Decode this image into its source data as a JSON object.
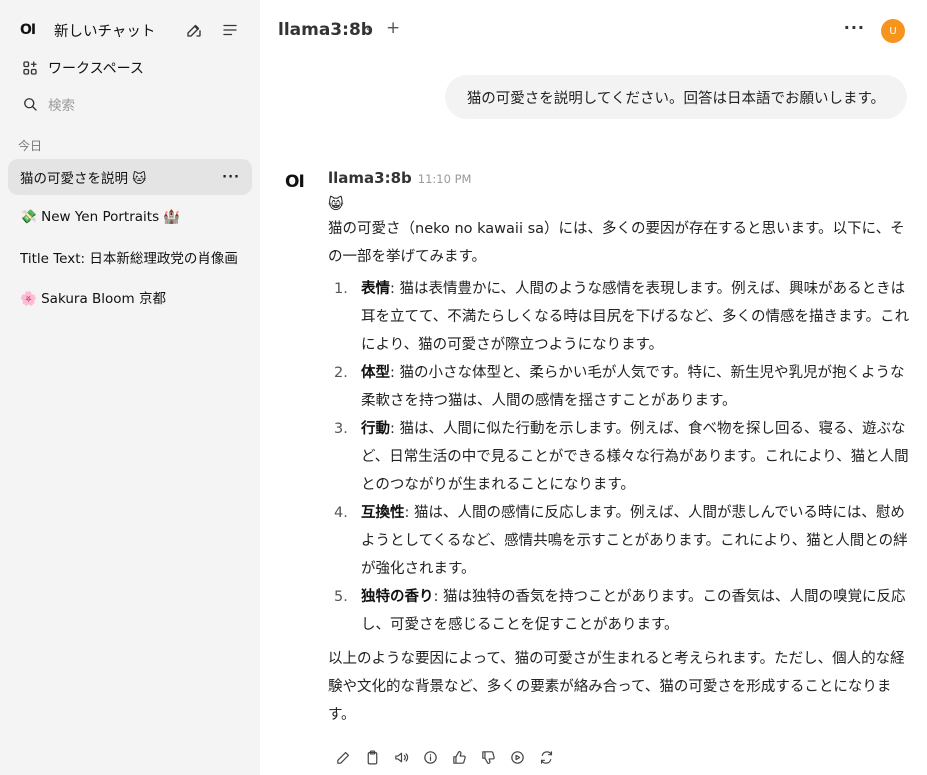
{
  "sidebar": {
    "logo": "OI",
    "new_chat": "新しいチャット",
    "workspace": "ワークスペース",
    "search_placeholder": "検索",
    "section_today": "今日",
    "chats": [
      {
        "label": "猫の可愛さを説明 🐱"
      },
      {
        "label": "💸 New Yen Portraits 🏰"
      },
      {
        "label": "Title Text: 日本新総理政党の肖像画"
      },
      {
        "label": "🌸 Sakura Bloom 京都"
      }
    ]
  },
  "header": {
    "model": "llama3:8b",
    "chevron": "⌄",
    "plus": "+",
    "more": "···",
    "avatar_initial": "U",
    "avatar_color": "#f7941d"
  },
  "user_message": "猫の可愛さを説明してください。回答は日本語でお願いします。",
  "assistant": {
    "logo": "OI",
    "name": "llama3:8b",
    "time": "11:10 PM",
    "emoji": "😸",
    "intro": "猫の可愛さ（neko no kawaii sa）には、多くの要因が存在すると思います。以下に、その一部を挙げてみます。",
    "points": [
      {
        "num": "1.",
        "title": "表情",
        "text": ": 猫は表情豊かに、人間のような感情を表現します。例えば、興味があるときは耳を立てて、不満たらしくなる時は目尻を下げるなど、多くの情感を描きます。これにより、猫の可愛さが際立つようになります。"
      },
      {
        "num": "2.",
        "title": "体型",
        "text": ": 猫の小さな体型と、柔らかい毛が人気です。特に、新生児や乳児が抱くような柔軟さを持つ猫は、人間の感情を揺さすことがあります。"
      },
      {
        "num": "3.",
        "title": "行動",
        "text": ": 猫は、人間に似た行動を示します。例えば、食べ物を探し回る、寝る、遊ぶなど、日常生活の中で見ることができる様々な行為があります。これにより、猫と人間とのつながりが生まれることになります。"
      },
      {
        "num": "4.",
        "title": "互換性",
        "text": ": 猫は、人間の感情に反応します。例えば、人間が悲しんでいる時には、慰めようとしてくるなど、感情共鳴を示すことがあります。これにより、猫と人間との絆が強化されます。"
      },
      {
        "num": "5.",
        "title": "独特の香り",
        "text": ": 猫は独特の香気を持つことがあります。この香気は、人間の嗅覚に反応し、可愛さを感じることを促すことがあります。"
      }
    ],
    "conclusion": "以上のような要因によって、猫の可愛さが生まれると考えられます。ただし、個人的な経験や文化的な背景など、多くの要素が絡み合って、猫の可愛さを形成することになります。"
  }
}
